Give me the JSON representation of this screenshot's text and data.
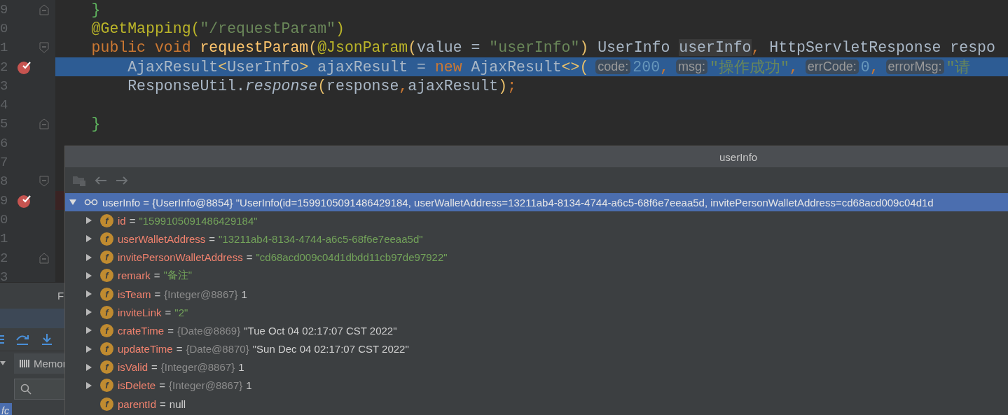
{
  "editor": {
    "lines": [
      {
        "number": "9",
        "fold_start": false,
        "fold_end": true,
        "breakpoint": false,
        "highlighted": false,
        "tokens": [
          {
            "text": "    }",
            "kind": "brace"
          }
        ]
      },
      {
        "number": "0",
        "fold_start": false,
        "fold_end": false,
        "breakpoint": false,
        "highlighted": false,
        "tokens": [
          {
            "text": "    @GetMapping(",
            "kind": "annotation"
          },
          {
            "text": "\"/requestParam\"",
            "kind": "string"
          },
          {
            "text": ")",
            "kind": "annotation"
          }
        ]
      },
      {
        "number": "1",
        "fold_start": true,
        "fold_end": false,
        "breakpoint": false,
        "highlighted": false,
        "tokens": [
          {
            "text": "    public void ",
            "kind": "keyword"
          },
          {
            "text": "requestParam",
            "kind": "method"
          },
          {
            "text": "(",
            "kind": "paren"
          },
          {
            "text": "@JsonParam",
            "kind": "annotation"
          },
          {
            "text": "(",
            "kind": "paren"
          },
          {
            "text": "value = ",
            "kind": "plain"
          },
          {
            "text": "\"userInfo\"",
            "kind": "string"
          },
          {
            "text": ")",
            "kind": "paren"
          },
          {
            "text": " UserInfo ",
            "kind": "plain"
          },
          {
            "text": "userInfo",
            "kind": "usage"
          },
          {
            "text": ",",
            "kind": "keyword"
          },
          {
            "text": " HttpServletResponse respo",
            "kind": "plain"
          }
        ]
      },
      {
        "number": "2",
        "fold_start": false,
        "fold_end": false,
        "breakpoint": true,
        "highlighted": true,
        "tokens": [
          {
            "text": "        AjaxResult",
            "kind": "plain"
          },
          {
            "text": "<",
            "kind": "paren"
          },
          {
            "text": "UserInfo",
            "kind": "plain"
          },
          {
            "text": ">",
            "kind": "paren"
          },
          {
            "text": " ajaxResult = ",
            "kind": "plain"
          },
          {
            "text": "new",
            "kind": "keyword"
          },
          {
            "text": " AjaxResult",
            "kind": "plain"
          },
          {
            "text": "<>(",
            "kind": "paren"
          },
          {
            "text": "code:",
            "kind": "hint"
          },
          {
            "text": "200",
            "kind": "number"
          },
          {
            "text": ",",
            "kind": "keyword"
          },
          {
            "text": "msg:",
            "kind": "hint"
          },
          {
            "text": "\"操作成功\"",
            "kind": "string"
          },
          {
            "text": ",",
            "kind": "keyword"
          },
          {
            "text": "errCode:",
            "kind": "hint"
          },
          {
            "text": "0",
            "kind": "number"
          },
          {
            "text": ",",
            "kind": "keyword"
          },
          {
            "text": "errorMsg:",
            "kind": "hint"
          },
          {
            "text": "\"请",
            "kind": "string"
          }
        ]
      },
      {
        "number": "3",
        "fold_start": false,
        "fold_end": false,
        "breakpoint": false,
        "highlighted": false,
        "tokens": [
          {
            "text": "        ResponseUtil.",
            "kind": "plain"
          },
          {
            "text": "response",
            "kind": "italic"
          },
          {
            "text": "(",
            "kind": "paren"
          },
          {
            "text": "response",
            "kind": "plain"
          },
          {
            "text": ",",
            "kind": "keyword"
          },
          {
            "text": "ajaxResult",
            "kind": "plain"
          },
          {
            "text": ")",
            "kind": "paren"
          },
          {
            "text": ";",
            "kind": "keyword"
          }
        ]
      },
      {
        "number": "4",
        "fold_start": false,
        "fold_end": false,
        "breakpoint": false,
        "highlighted": false
      },
      {
        "number": "5",
        "fold_start": false,
        "fold_end": true,
        "breakpoint": false,
        "highlighted": false,
        "tokens": [
          {
            "text": "    }",
            "kind": "brace"
          }
        ]
      },
      {
        "number": "6",
        "fold_start": false,
        "fold_end": false,
        "breakpoint": false,
        "highlighted": false
      },
      {
        "number": "7",
        "fold_start": false,
        "fold_end": false,
        "breakpoint": false,
        "highlighted": false
      },
      {
        "number": "8",
        "fold_start": true,
        "fold_end": false,
        "breakpoint": false,
        "highlighted": false
      },
      {
        "number": "9",
        "fold_start": false,
        "fold_end": false,
        "breakpoint": true,
        "highlighted": false
      },
      {
        "number": "0",
        "fold_start": false,
        "fold_end": false,
        "breakpoint": false,
        "highlighted": false
      },
      {
        "number": "1",
        "fold_start": false,
        "fold_end": false,
        "breakpoint": false,
        "highlighted": false
      },
      {
        "number": "2",
        "fold_start": false,
        "fold_end": true,
        "breakpoint": false,
        "highlighted": false
      },
      {
        "number": "3",
        "fold_start": false,
        "fold_end": false,
        "breakpoint": false,
        "highlighted": false
      }
    ]
  },
  "debug_panel": {
    "tab": "F",
    "memory_tab": "Memor",
    "selected_item": "fc"
  },
  "popup": {
    "title": "userInfo",
    "root": {
      "name": "userInfo",
      "eq": "=",
      "type": "{UserInfo@8854}",
      "value": "\"UserInfo(id=1599105091486429184, userWalletAddress=13211ab4-8134-4744-a6c5-68f6e7eeaa5d, invitePersonWalletAddress=cd68acd009c04d1d",
      "expanded": true,
      "selected": true
    },
    "fields": [
      {
        "badge": "f",
        "name": "id",
        "eq": "=",
        "value": "\"1599105091486429184\"",
        "kind": "string",
        "expandable": true
      },
      {
        "badge": "f",
        "name": "userWalletAddress",
        "eq": "=",
        "value": "\"13211ab4-8134-4744-a6c5-68f6e7eeaa5d\"",
        "kind": "string",
        "expandable": true
      },
      {
        "badge": "f",
        "name": "invitePersonWalletAddress",
        "eq": "=",
        "value": "\"cd68acd009c04d1dbdd11cb97de97922\"",
        "kind": "string",
        "expandable": true
      },
      {
        "badge": "f",
        "name": "remark",
        "eq": "=",
        "value": "\"备注\"",
        "kind": "string",
        "expandable": true
      },
      {
        "badge": "f",
        "name": "isTeam",
        "eq": "=",
        "type": "{Integer@8867}",
        "value": "1",
        "kind": "plain",
        "expandable": true
      },
      {
        "badge": "f",
        "name": "inviteLink",
        "eq": "=",
        "value": "\"2\"",
        "kind": "string",
        "expandable": true
      },
      {
        "badge": "f",
        "name": "crateTime",
        "eq": "=",
        "type": "{Date@8869}",
        "value": "\"Tue Oct 04 02:17:07 CST 2022\"",
        "kind": "plain",
        "expandable": true
      },
      {
        "badge": "f",
        "name": "updateTime",
        "eq": "=",
        "type": "{Date@8870}",
        "value": "\"Sun Dec 04 02:17:07 CST 2022\"",
        "kind": "plain",
        "expandable": true
      },
      {
        "badge": "f",
        "name": "isValid",
        "eq": "=",
        "type": "{Integer@8867}",
        "value": "1",
        "kind": "plain",
        "expandable": true
      },
      {
        "badge": "f",
        "name": "isDelete",
        "eq": "=",
        "type": "{Integer@8867}",
        "value": "1",
        "kind": "plain",
        "expandable": true
      },
      {
        "badge": "f",
        "name": "parentId",
        "eq": "=",
        "value": "null",
        "kind": "plain",
        "expandable": false
      }
    ]
  }
}
